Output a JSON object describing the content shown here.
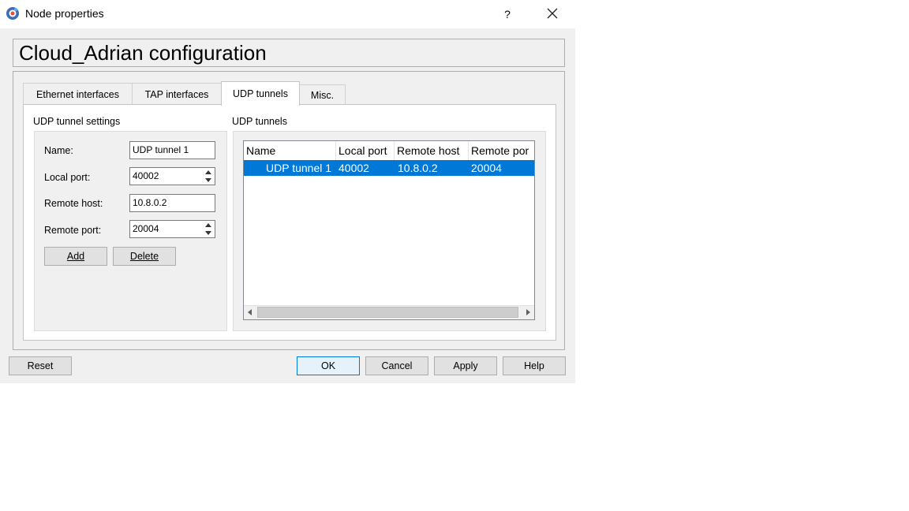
{
  "window": {
    "title": "Node properties",
    "help_label": "?",
    "close_label": "close"
  },
  "header": {
    "title": "Cloud_Adrian configuration"
  },
  "tabs": [
    {
      "label": "Ethernet interfaces",
      "active": false
    },
    {
      "label": "TAP interfaces",
      "active": false
    },
    {
      "label": "UDP tunnels",
      "active": true
    },
    {
      "label": "Misc.",
      "active": false
    }
  ],
  "settings": {
    "group_label": "UDP tunnel settings",
    "name_label": "Name:",
    "name_value": "UDP tunnel 1",
    "local_port_label": "Local port:",
    "local_port_value": "40002",
    "remote_host_label": "Remote host:",
    "remote_host_value": "10.8.0.2",
    "remote_port_label": "Remote port:",
    "remote_port_value": "20004",
    "add_label": "Add",
    "delete_label": "Delete"
  },
  "tunnels": {
    "group_label": "UDP tunnels",
    "columns": [
      "Name",
      "Local port",
      "Remote host",
      "Remote por"
    ],
    "rows": [
      {
        "name": "UDP tunnel 1",
        "local_port": "40002",
        "remote_host": "10.8.0.2",
        "remote_port": "20004",
        "selected": true
      }
    ]
  },
  "footer": {
    "reset_label": "Reset",
    "ok_label": "OK",
    "cancel_label": "Cancel",
    "apply_label": "Apply",
    "help_label": "Help"
  },
  "colors": {
    "selection": "#0078d7",
    "window_bg": "#f0f0f0",
    "panel_bg": "#ffffff"
  }
}
